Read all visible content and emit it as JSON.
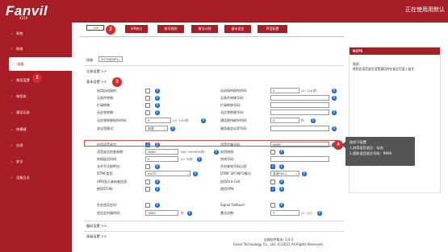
{
  "header": {
    "logo": "Fanvil",
    "model": "X210",
    "user_text": "正在使用用默认"
  },
  "sidebar": {
    "items": [
      {
        "label": "系统"
      },
      {
        "label": "网络"
      },
      {
        "label": "线路"
      },
      {
        "label": "电话设置"
      },
      {
        "label": "电话本"
      },
      {
        "label": "通话记录"
      },
      {
        "label": "快捷键"
      },
      {
        "label": "应用"
      },
      {
        "label": "安全"
      },
      {
        "label": "设备日志"
      }
    ],
    "active_index": 2
  },
  "tabs": [
    {
      "label": "SIP"
    },
    {
      "label": "SIP热点"
    },
    {
      "label": "拨号规则"
    },
    {
      "label": "拨号计划"
    },
    {
      "label": "基本设定"
    },
    {
      "label": "声音配置"
    }
  ],
  "markers": {
    "m1": "1",
    "m2": "2",
    "m3": "3",
    "m4": "4"
  },
  "line": {
    "label": "线路",
    "value": "5073@SIP1"
  },
  "sections": {
    "register": "注册设置 >>",
    "basic": "基本设置 >>",
    "codec": "编码设置 >>",
    "advanced": "高级设置 >>"
  },
  "left_rows": [
    {
      "label": "启用自动接听:"
    },
    {
      "label": "无条件转移:"
    },
    {
      "label": "忙碌转移:"
    },
    {
      "label": "无应答转移:"
    },
    {
      "label": "无应答转移振铃时间:",
      "value": "5",
      "unit": "(0~120)秒"
    },
    {
      "label": "会议室模式:",
      "value": "本地"
    },
    {
      "label": "启用语音留言:"
    },
    {
      "label": "语音留言检查周期:",
      "value": "3600",
      "unit": "(60~999999)秒"
    },
    {
      "label": "热线延迟时间:",
      "value": "0",
      "unit": "(0~9)秒"
    },
    {
      "label": "允许不注册呼出:"
    },
    {
      "label": "DTMF类型:",
      "value": "AUTO"
    },
    {
      "label": "UPEI显示来电者信息:"
    },
    {
      "label": "使用STUN:"
    },
    {
      "label": "开启会话定时:"
    },
    {
      "label": "会话定时器时间:",
      "value": "1800",
      "unit": "秒"
    }
  ],
  "right_rows": [
    {
      "label": "自动接听振铃时间:",
      "value": "5",
      "unit": "(0~120)秒"
    },
    {
      "label": "无条件转移号码:"
    },
    {
      "label": "忙碌转移号码:"
    },
    {
      "label": "无应答转移号码:"
    },
    {
      "label": "通话保持振铃时间:",
      "value": "0",
      "unit": "秒"
    },
    {
      "label": "服务器会议室号码:"
    },
    {
      "label": "语音信箱号码:",
      "value": "9999"
    },
    {
      "label": "启用热线:"
    },
    {
      "label": "热线号码:"
    },
    {
      "label": "开启来电号码过滤:"
    },
    {
      "label": "DTMF SIP INFO模式:",
      "value": "发送*#11"
    },
    {
      "label": "启用Out-Call:"
    },
    {
      "label": "使用VPN:"
    },
    {
      "label": "Signal Fallback:"
    },
    {
      "label": "重试次数:",
      "value": "3",
      "unit": "(1~10)"
    }
  ],
  "note": {
    "title": "NOTE",
    "sub": "描述:",
    "body": "使用此语音留言设置通话时在留言页面上留言"
  },
  "tooltip": {
    "line1": "按如下配置",
    "line2": "1.启用语音留言：勾选",
    "line3": "2.提取语音留言号码：9999"
  },
  "footer": {
    "line1": "当前软件版本: 2.4.2",
    "line2": "Fanvil Technology Co., Ltd. (C)2021 All Rights Reserved."
  },
  "colors": {
    "brand": "#a81e27",
    "accent": "#2d6bd0",
    "marker": "#d62b2b"
  }
}
